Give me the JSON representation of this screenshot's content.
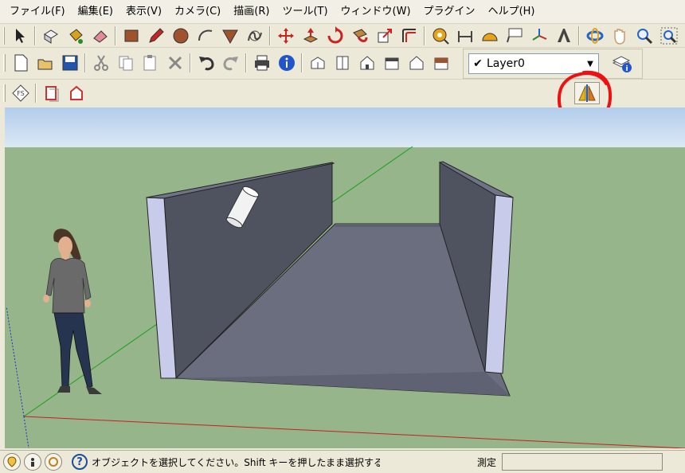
{
  "menu": [
    "ファイル(F)",
    "編集(E)",
    "表示(V)",
    "カメラ(C)",
    "描画(R)",
    "ツール(T)",
    "ウィンドウ(W)",
    "プラグイン",
    "ヘルプ(H)"
  ],
  "toolbar_main": [
    {
      "name": "select-icon",
      "color": "#222222"
    },
    {
      "name": "make-component-icon",
      "color": "#f0f0f0"
    },
    {
      "name": "paint-bucket-icon",
      "color": "#d9a21b"
    },
    {
      "name": "eraser-icon",
      "color": "#e58a9a"
    },
    {
      "name": "rectangle-icon",
      "color": "#a0522d"
    },
    {
      "name": "pencil-icon",
      "color": "#cc2222"
    },
    {
      "name": "circle-icon",
      "color": "#a0522d"
    },
    {
      "name": "arc-icon",
      "color": "#444444"
    },
    {
      "name": "polygon-icon",
      "color": "#a0522d"
    },
    {
      "name": "freehand-icon",
      "color": "#444444"
    },
    {
      "name": "move-icon",
      "color": "#cc2222"
    },
    {
      "name": "push-pull-icon",
      "color": "#cc2222"
    },
    {
      "name": "rotate-icon",
      "color": "#cc2222"
    },
    {
      "name": "follow-me-icon",
      "color": "#cc2222"
    },
    {
      "name": "scale-icon",
      "color": "#cc2222"
    },
    {
      "name": "offset-icon",
      "color": "#cc2222"
    },
    {
      "name": "tape-measure-icon",
      "color": "#e8a317"
    },
    {
      "name": "dimension-icon",
      "color": "#444444"
    },
    {
      "name": "protractor-icon",
      "color": "#e8a317"
    },
    {
      "name": "text-icon",
      "color": "#444444"
    },
    {
      "name": "axes-icon",
      "color": "#2266cc"
    },
    {
      "name": "3d-text-icon",
      "color": "#444444"
    },
    {
      "name": "orbit-icon",
      "color": "#2266cc"
    },
    {
      "name": "pan-icon",
      "color": "#cc9966"
    },
    {
      "name": "zoom-icon",
      "color": "#2266cc"
    },
    {
      "name": "zoom-window-icon",
      "color": "#2266cc"
    },
    {
      "name": "zoom-extents-icon",
      "color": "#2266cc"
    }
  ],
  "toolbar_std": [
    {
      "name": "new-file-icon",
      "color": "#ffffff"
    },
    {
      "name": "open-file-icon",
      "color": "#e8c26a"
    },
    {
      "name": "save-icon",
      "color": "#2255aa"
    },
    {
      "name": "cut-icon",
      "color": "#888888"
    },
    {
      "name": "copy-icon",
      "color": "#888888"
    },
    {
      "name": "paste-icon",
      "color": "#888888"
    },
    {
      "name": "delete-icon",
      "color": "#888888"
    },
    {
      "name": "undo-icon",
      "color": "#333333"
    },
    {
      "name": "redo-icon",
      "color": "#999999"
    },
    {
      "name": "print-icon",
      "color": "#444444"
    },
    {
      "name": "model-info-icon",
      "color": "#2255cc"
    },
    {
      "name": "iso-view-icon",
      "color": "#444444"
    },
    {
      "name": "top-view-icon",
      "color": "#444444"
    },
    {
      "name": "front-view-icon",
      "color": "#444444"
    },
    {
      "name": "right-view-icon",
      "color": "#444444"
    },
    {
      "name": "back-view-icon",
      "color": "#444444"
    },
    {
      "name": "left-view-icon",
      "color": "#444444"
    }
  ],
  "toolbar_third": [
    {
      "name": "sandbox-icon",
      "color": "#444444"
    },
    {
      "name": "section-plane-icon",
      "color": "#cc3333"
    },
    {
      "name": "section-display-icon",
      "color": "#cc3333"
    }
  ],
  "layer": {
    "check": "✔",
    "name": "Layer0",
    "dropdown": "▼"
  },
  "colors": {
    "sky": "#b9d4ee",
    "ground": "#97b58a",
    "wall": "#4f5360",
    "floor": "#6b6e7e",
    "wall_edge": "#c8cbea",
    "annotation": "#ee1111"
  },
  "status": {
    "help_icon": "?",
    "text": "オブジェクトを選択してください。Shift キーを押したまま選択するか、ま",
    "measure_label": "測定",
    "measure_value": ""
  }
}
